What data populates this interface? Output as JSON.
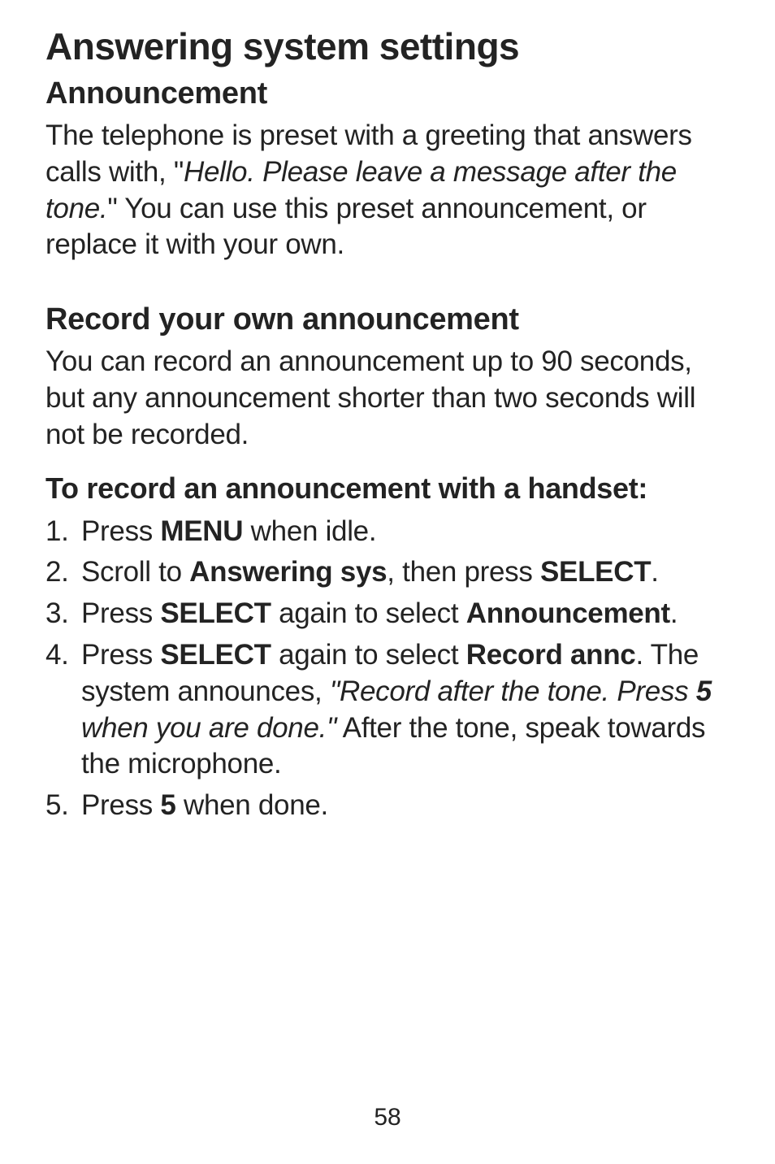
{
  "title": "Answering system settings",
  "section1": {
    "heading": "Announcement",
    "para_prefix": "The telephone is preset with a greeting that answers calls with, \"",
    "para_italic": "Hello. Please leave a message after the tone.",
    "para_suffix": "\" You can use this preset announcement, or replace it with your own."
  },
  "section2": {
    "heading": "Record your own announcement",
    "para": "You can record an announcement up to 90 seconds, but any announcement shorter than two seconds will not be recorded."
  },
  "subheading": "To record an announcement with a handset:",
  "steps": {
    "s1_num": "1.",
    "s1_a": "Press ",
    "s1_b": "MENU",
    "s1_c": " when idle.",
    "s2_num": "2.",
    "s2_a": "Scroll to ",
    "s2_b": "Answering sys",
    "s2_c": ", then press ",
    "s2_d": "SELECT",
    "s2_e": ".",
    "s3_num": "3.",
    "s3_a": "Press ",
    "s3_b": "SELECT",
    "s3_c": " again to select ",
    "s3_d": "Announcement",
    "s3_e": ".",
    "s4_num": "4.",
    "s4_a": "Press ",
    "s4_b": "SELECT",
    "s4_c": " again to select ",
    "s4_d": "Record annc",
    "s4_e": ". The system announces, ",
    "s4_f": "\"Record after the tone. Press ",
    "s4_g": "5",
    "s4_h": " when you are done.\"",
    "s4_i": " After the tone, speak towards the microphone.",
    "s5_num": "5.",
    "s5_a": "Press ",
    "s5_b": "5",
    "s5_c": " when done."
  },
  "page_number": "58"
}
